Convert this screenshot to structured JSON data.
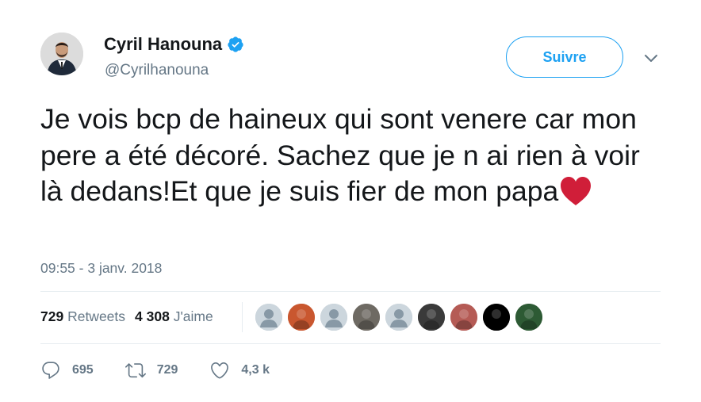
{
  "author": {
    "name": "Cyril Hanouna",
    "handle": "@Cyrilhanouna"
  },
  "follow_button": {
    "label": "Suivre"
  },
  "tweet": {
    "text": "Je vois bcp de haineux qui sont venere car mon pere a été décoré. Sachez que je n ai rien à voir là dedans!Et que je suis fier de mon papa",
    "emoji": "red-heart",
    "timestamp": "09:55 - 3 janv. 2018"
  },
  "stats": {
    "retweets_count": "729",
    "retweets_label": "Retweets",
    "likes_count": "4 308",
    "likes_label": "J'aime"
  },
  "likers": [
    {
      "kind": "default-avatar",
      "color": "#ccd6dd"
    },
    {
      "kind": "photo",
      "color": "#c9572f"
    },
    {
      "kind": "default-avatar",
      "color": "#ccd6dd"
    },
    {
      "kind": "photo",
      "color": "#6e6a63"
    },
    {
      "kind": "default-avatar",
      "color": "#ccd6dd"
    },
    {
      "kind": "photo",
      "color": "#3a3a3a"
    },
    {
      "kind": "photo",
      "color": "#b55b55"
    },
    {
      "kind": "photo",
      "color": "#000000"
    },
    {
      "kind": "photo",
      "color": "#2d5a34"
    }
  ],
  "actions": {
    "reply_count": "695",
    "retweet_count": "729",
    "like_count": "4,3 k"
  },
  "colors": {
    "accent": "#1da1f2",
    "muted": "#657786",
    "heart": "#d01e39"
  }
}
